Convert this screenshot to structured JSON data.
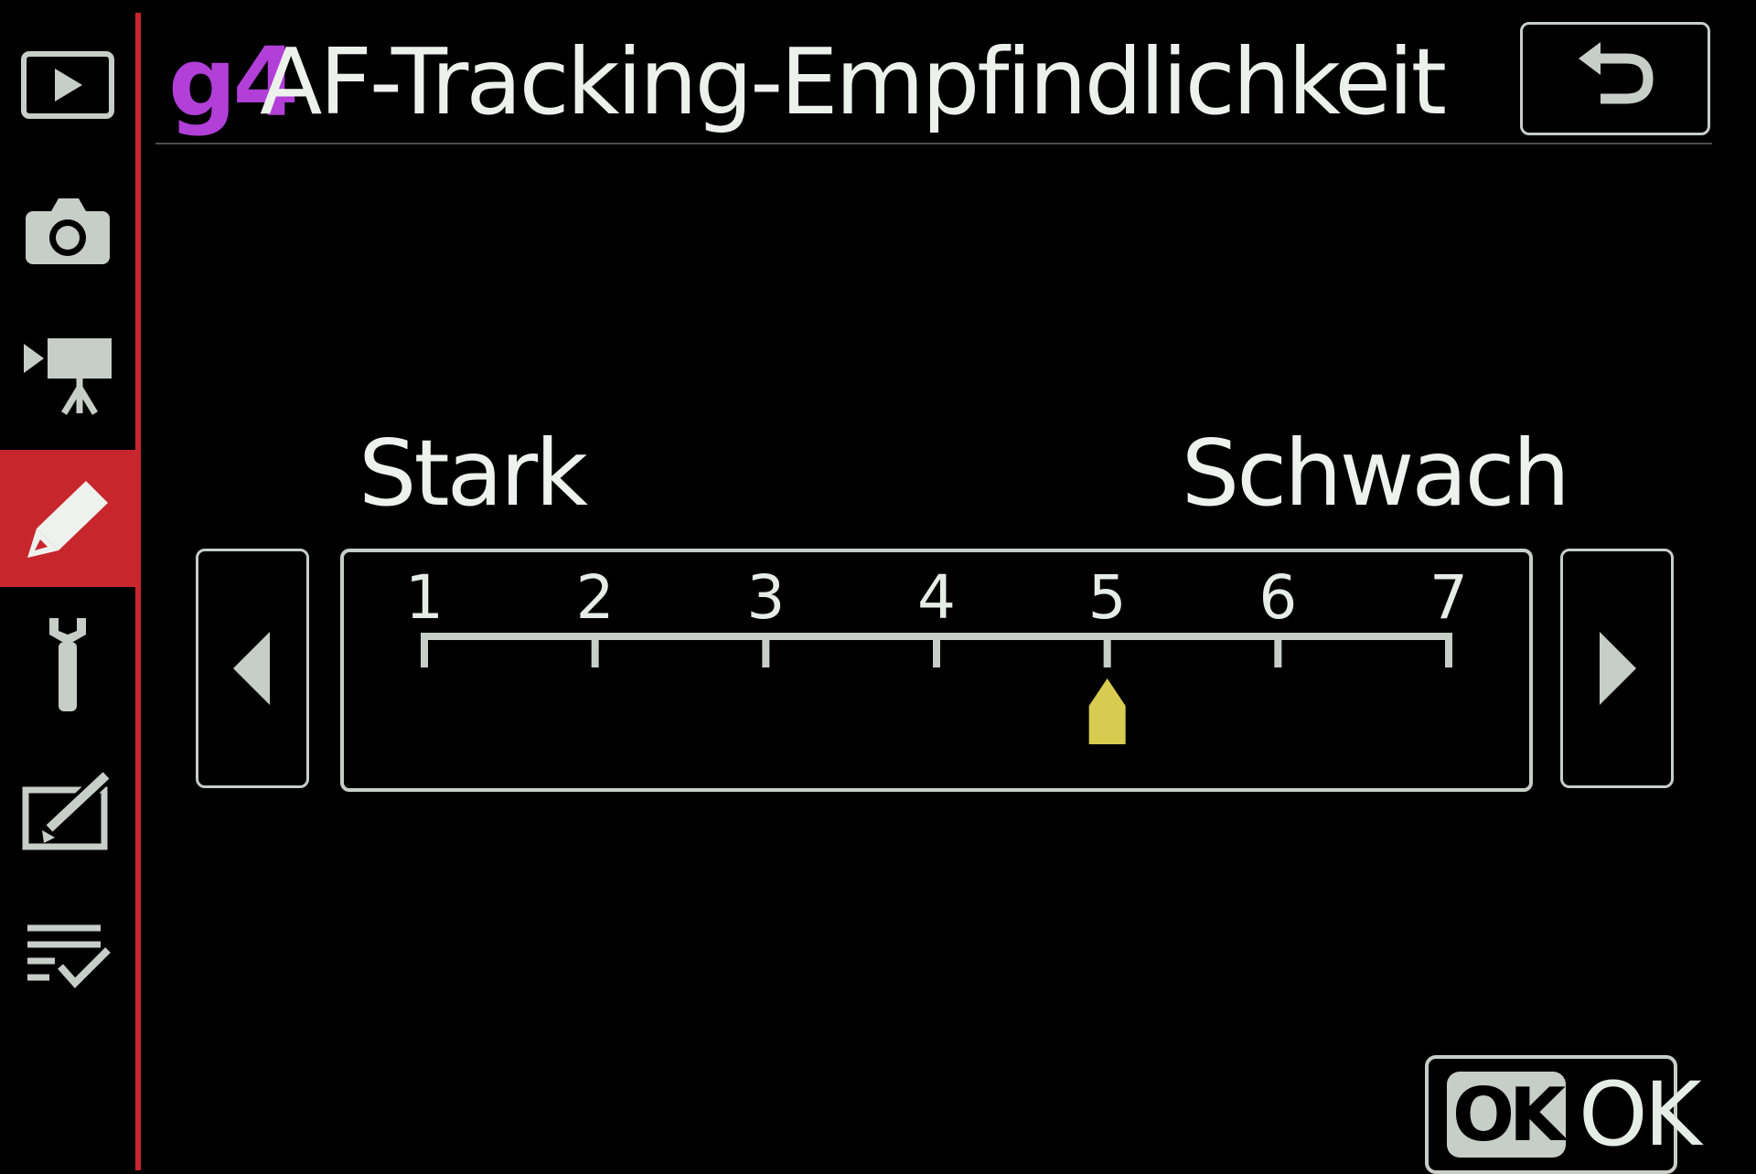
{
  "menu": {
    "tabs": [
      {
        "icon": "playback-icon",
        "active": false
      },
      {
        "icon": "camera-icon",
        "active": false
      },
      {
        "icon": "movie-camera-icon",
        "active": false
      },
      {
        "icon": "pencil-icon",
        "active": true
      },
      {
        "icon": "wrench-icon",
        "active": false
      },
      {
        "icon": "retouch-icon",
        "active": false
      },
      {
        "icon": "my-menu-icon",
        "active": false
      }
    ],
    "accent_color": "#c8262d"
  },
  "header": {
    "code": "g4",
    "title": "AF-Tracking-Empfindlichkeit",
    "code_color": "#b13fd8",
    "back_icon": "return-icon"
  },
  "scale": {
    "left_label": "Stark",
    "right_label": "Schwach",
    "ticks": [
      "1",
      "2",
      "3",
      "4",
      "5",
      "6",
      "7"
    ],
    "selected": 5,
    "marker_color": "#d8cb50",
    "left_arrow_icon": "arrow-left-icon",
    "right_arrow_icon": "arrow-right-icon"
  },
  "footer": {
    "ok_badge": "OK",
    "ok_label": "OK"
  }
}
